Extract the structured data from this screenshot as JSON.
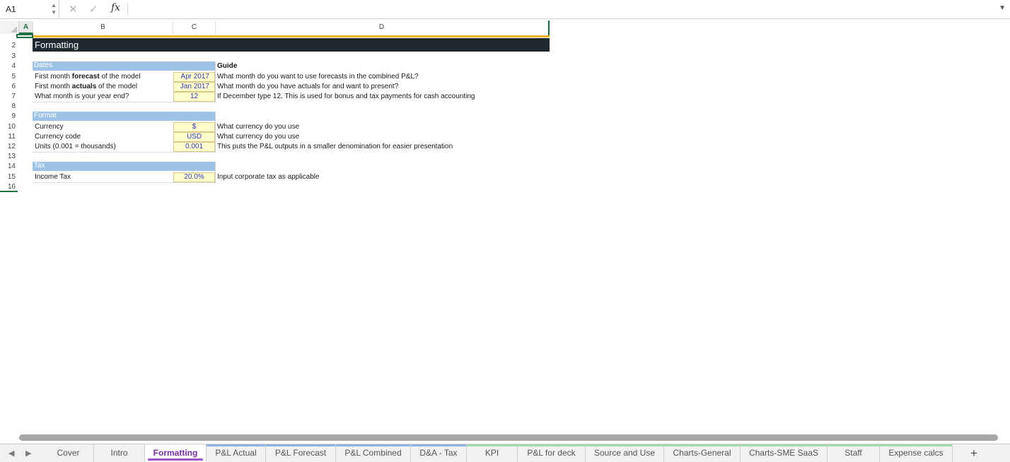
{
  "formula_bar": {
    "cell_ref": "A1",
    "cancel_icon": "✕",
    "confirm_icon": "✓",
    "fx_label": "fx",
    "formula": ""
  },
  "columns": [
    "A",
    "B",
    "C",
    "D"
  ],
  "rows": [
    "2",
    "3",
    "4",
    "5",
    "6",
    "7",
    "8",
    "9",
    "10",
    "11",
    "12",
    "13",
    "14",
    "15",
    "16"
  ],
  "sheet": {
    "title": "Formatting",
    "guide_header": "Guide",
    "dates": {
      "section": "Dates",
      "forecast_pre": "First month ",
      "forecast_bold": "forecast",
      "forecast_post": " of the model",
      "forecast_value": "Apr 2017",
      "forecast_guide": "What month do you want to use forecasts in the combined P&L?",
      "actuals_pre": "First month ",
      "actuals_bold": "actuals",
      "actuals_post": " of the model",
      "actuals_value": "Jan 2017",
      "actuals_guide": "What month do you have actuals for and want to present?",
      "year_end_label": "What month is your year end?",
      "year_end_value": "12",
      "year_end_guide": "If December type 12. This is used for bonus and tax payments for cash accounting"
    },
    "format": {
      "section": "Format",
      "currency_label": "Currency",
      "currency_value": "$",
      "currency_guide": "What currency do you use",
      "code_label": "Currency code",
      "code_value": "USD",
      "code_guide": "What currency do you use",
      "units_label": "Units (0.001 = thousands)",
      "units_value": "0.001",
      "units_guide": "This puts the P&L outputs in a smaller denomination for easier presentation"
    },
    "tax": {
      "section": "Tax",
      "income_label": "Income Tax",
      "income_value": "20.0%",
      "income_guide": "Input corporate tax as applicable"
    }
  },
  "tabs": [
    {
      "label": "Cover",
      "color": ""
    },
    {
      "label": "Intro",
      "color": ""
    },
    {
      "label": "Formatting",
      "color": "#a14fd0"
    },
    {
      "label": "P&L Actual",
      "color": "#8fb0e0"
    },
    {
      "label": "P&L Forecast",
      "color": "#8fb0e0"
    },
    {
      "label": "P&L Combined",
      "color": "#8fb0e0"
    },
    {
      "label": "D&A - Tax",
      "color": "#8fb0e0"
    },
    {
      "label": "KPI",
      "color": "#9fdcae"
    },
    {
      "label": "P&L for deck",
      "color": "#9fdcae"
    },
    {
      "label": "Source and Use",
      "color": "#9fdcae"
    },
    {
      "label": "Charts-General",
      "color": "#9fdcae"
    },
    {
      "label": "Charts-SME SaaS",
      "color": "#9fdcae"
    },
    {
      "label": "Staff",
      "color": "#9fdcae"
    },
    {
      "label": "Expense calcs",
      "color": "#9fdcae"
    }
  ],
  "add_sheet_label": "+",
  "colors": {
    "accent_green": "#1e7145",
    "gold": "#f2b000",
    "section_blue": "#9dc3e6",
    "input_yellow": "#ffffcc",
    "input_text": "#2f38c9",
    "title_band": "#1f2a30",
    "active_tab": "#7a2dad"
  }
}
